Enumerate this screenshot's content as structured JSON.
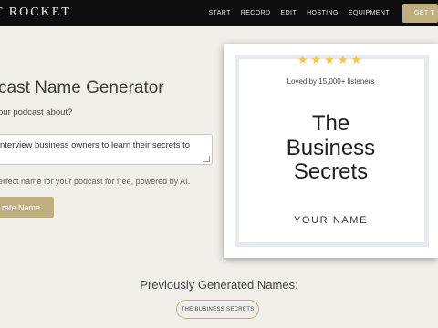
{
  "brand": {
    "logo_text": "T ROCKET"
  },
  "nav": {
    "items": [
      "START",
      "RECORD",
      "EDIT",
      "HOSTING",
      "EQUIPMENT"
    ],
    "cta_label": "GET T"
  },
  "form": {
    "heading": "cast Name Generator",
    "question": "our podcast about?",
    "input_value": "nterview business owners to learn their secrets to",
    "hint": "erfect name for your podcast for free, powered by AI.",
    "button_label": "rate Name"
  },
  "preview": {
    "stars": "★★★★★",
    "loved_text": "Loved by 15,000+ listeners",
    "title_lines": [
      "The",
      "Business",
      "Secrets"
    ],
    "author": "YOUR NAME"
  },
  "previous": {
    "heading": "Previously Generated Names:",
    "items": [
      "THE BUSINESS SECRETS"
    ]
  }
}
